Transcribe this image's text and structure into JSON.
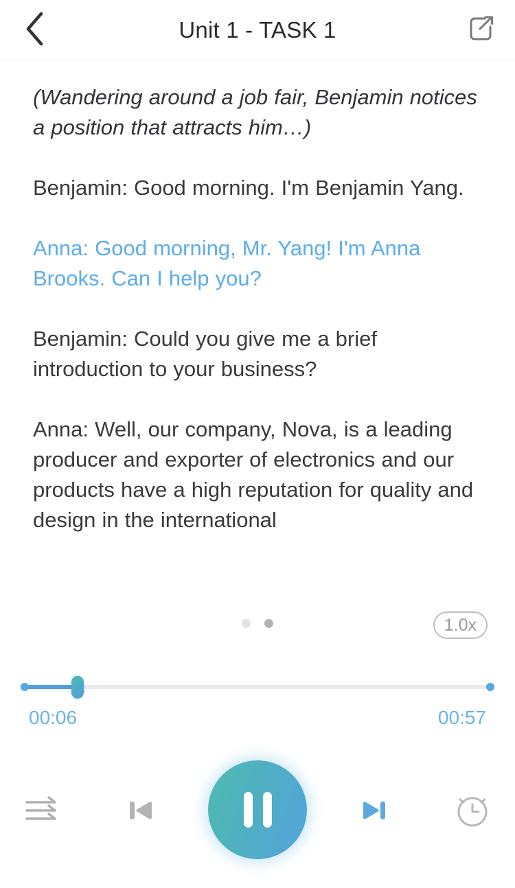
{
  "header": {
    "title": "Unit 1 - TASK 1",
    "back_icon": "chevron-left-icon",
    "share_icon": "share-icon"
  },
  "transcript": {
    "paragraphs": [
      {
        "id": "stage-direction",
        "text": "(Wandering around a job fair, Benjamin notices a position that attracts him…)",
        "style": "stage"
      },
      {
        "id": "line-benjamin-1",
        "text": "Benjamin: Good morning. I'm Benjamin Yang.",
        "style": "normal"
      },
      {
        "id": "line-anna-1",
        "text": "Anna: Good morning, Mr. Yang! I'm Anna Brooks. Can I help you?",
        "style": "highlight"
      },
      {
        "id": "line-benjamin-2",
        "text": "Benjamin: Could you give me a brief introduction to your business?",
        "style": "normal"
      },
      {
        "id": "line-anna-2",
        "text": "Anna: Well, our company, Nova, is a leading producer and exporter of electronics and our products have a high reputation for quality and design in the international",
        "style": "normal"
      }
    ]
  },
  "pager": {
    "dots": [
      {
        "label": "page-1",
        "active": false
      },
      {
        "label": "page-2",
        "active": true
      }
    ]
  },
  "speed": {
    "label": "1.0x"
  },
  "player": {
    "current_time": "00:06",
    "total_time": "00:57",
    "progress_percent": 12,
    "state": "playing",
    "colors": {
      "accent_blue": "#57a7e0",
      "accent_teal": "#4fbcb0",
      "highlight_text": "#5cadeb",
      "time_text": "#6bb4e8"
    }
  },
  "controls": {
    "list_icon": "playlist-order-icon",
    "previous_icon": "previous-track-icon",
    "play_pause_icon": "pause-icon",
    "next_icon": "next-track-icon",
    "timer_icon": "alarm-clock-icon"
  }
}
